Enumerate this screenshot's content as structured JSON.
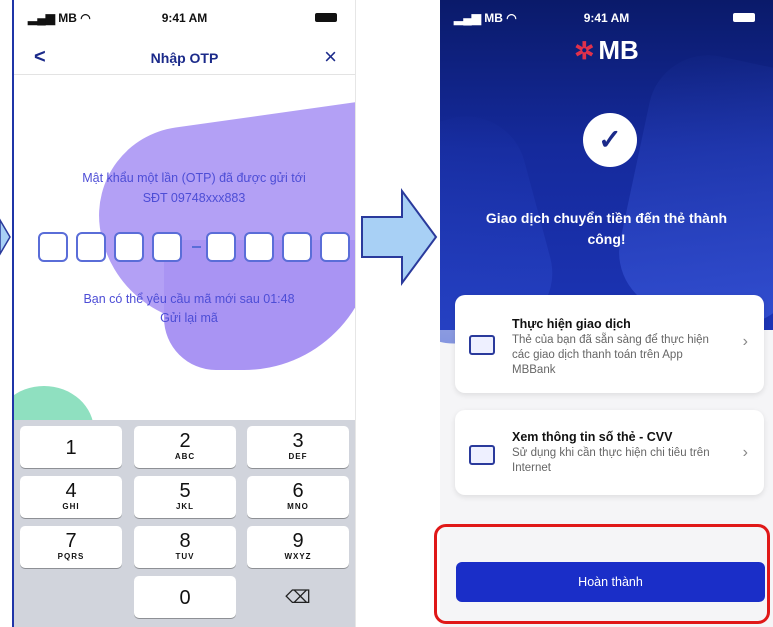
{
  "left_screen": {
    "status": {
      "signal": "MB",
      "time": "9:41 AM"
    },
    "nav": {
      "back": "<",
      "title": "Nhập OTP",
      "close": "×"
    },
    "otp_message": "Mật khẩu một lần (OTP) đã được gửi tới SĐT 09748xxx883",
    "resend_info": "Bạn có thể yêu cầu mã mới sau 01:48",
    "resend_link": "Gửi lại mã",
    "keypad": [
      {
        "digit": "1",
        "letters": ""
      },
      {
        "digit": "2",
        "letters": "ABC"
      },
      {
        "digit": "3",
        "letters": "DEF"
      },
      {
        "digit": "4",
        "letters": "GHI"
      },
      {
        "digit": "5",
        "letters": "JKL"
      },
      {
        "digit": "6",
        "letters": "MNO"
      },
      {
        "digit": "7",
        "letters": "PQRS"
      },
      {
        "digit": "8",
        "letters": "TUV"
      },
      {
        "digit": "9",
        "letters": "WXYZ"
      },
      {
        "digit": "0",
        "letters": ""
      }
    ],
    "backspace": "⌫"
  },
  "right_screen": {
    "status": {
      "signal": "MB",
      "time": "9:41 AM"
    },
    "logo": "MB",
    "success_title": "Giao dịch chuyển tiền đến thẻ thành công!",
    "cards": [
      {
        "title": "Thực hiện giao dịch",
        "desc": "Thẻ của bạn đã sẵn sàng để thực hiện các giao dịch thanh toán trên App MBBank",
        "chevron": "›"
      },
      {
        "title": "Xem thông tin số thẻ - CVV",
        "desc": "Sử dụng khi cần thực hiện chi tiêu trên Internet",
        "chevron": "›"
      }
    ],
    "done_button": "Hoàn thành"
  },
  "colors": {
    "brand_blue": "#1a2ec8",
    "otp_purple": "#b3a0f5",
    "highlight_red": "#e01818"
  }
}
